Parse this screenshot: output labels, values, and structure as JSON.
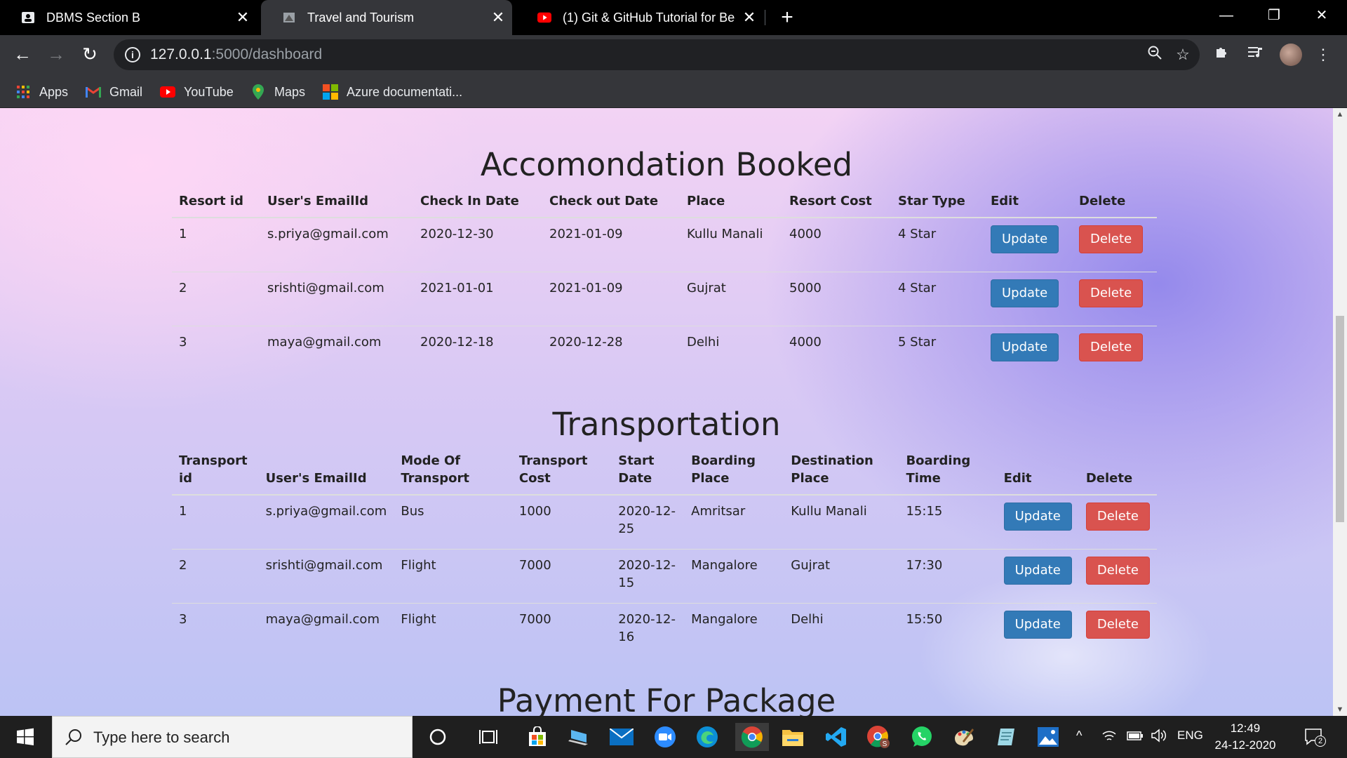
{
  "browser": {
    "tabs": [
      {
        "title": "DBMS Section B",
        "active": false
      },
      {
        "title": "Travel and Tourism",
        "active": true
      },
      {
        "title": "(1) Git & GitHub Tutorial for Begi",
        "active": false
      }
    ],
    "url_host": "127.0.0.1",
    "url_path": ":5000/dashboard",
    "bookmarks": [
      {
        "label": "Apps",
        "icon": "apps-grid-icon"
      },
      {
        "label": "Gmail",
        "icon": "gmail-icon"
      },
      {
        "label": "YouTube",
        "icon": "youtube-icon"
      },
      {
        "label": "Maps",
        "icon": "maps-pin-icon"
      },
      {
        "label": "Azure documentati...",
        "icon": "microsoft-logo-icon"
      }
    ]
  },
  "accommodation": {
    "title": "Accomondation Booked",
    "columns": [
      "Resort id",
      "User's EmailId",
      "Check In Date",
      "Check out Date",
      "Place",
      "Resort Cost",
      "Star Type",
      "Edit",
      "Delete"
    ],
    "rows": [
      {
        "id": "1",
        "email": "s.priya@gmail.com",
        "check_in": "2020-12-30",
        "check_out": "2021-01-09",
        "place": "Kullu Manali",
        "cost": "4000",
        "star": "4 Star"
      },
      {
        "id": "2",
        "email": "srishti@gmail.com",
        "check_in": "2021-01-01",
        "check_out": "2021-01-09",
        "place": "Gujrat",
        "cost": "5000",
        "star": "4 Star"
      },
      {
        "id": "3",
        "email": "maya@gmail.com",
        "check_in": "2020-12-18",
        "check_out": "2020-12-28",
        "place": "Delhi",
        "cost": "4000",
        "star": "5 Star"
      }
    ]
  },
  "transportation": {
    "title": "Transportation",
    "columns": [
      "Transport id",
      "User's EmailId",
      "Mode Of Transport",
      "Transport Cost",
      "Start Date",
      "Boarding Place",
      "Destination Place",
      "Boarding Time",
      "Edit",
      "Delete"
    ],
    "rows": [
      {
        "id": "1",
        "email": "s.priya@gmail.com",
        "mode": "Bus",
        "cost": "1000",
        "start": "2020-12-25",
        "boarding": "Amritsar",
        "destination": "Kullu Manali",
        "time": "15:15"
      },
      {
        "id": "2",
        "email": "srishti@gmail.com",
        "mode": "Flight",
        "cost": "7000",
        "start": "2020-12-15",
        "boarding": "Mangalore",
        "destination": "Gujrat",
        "time": "17:30"
      },
      {
        "id": "3",
        "email": "maya@gmail.com",
        "mode": "Flight",
        "cost": "7000",
        "start": "2020-12-16",
        "boarding": "Mangalore",
        "destination": "Delhi",
        "time": "15:50"
      }
    ]
  },
  "payment": {
    "title": "Payment For Package"
  },
  "buttons": {
    "update": "Update",
    "delete": "Delete"
  },
  "taskbar": {
    "search_placeholder": "Type here to search",
    "language": "ENG",
    "time": "12:49",
    "date": "24-12-2020",
    "notification_count": "2"
  }
}
